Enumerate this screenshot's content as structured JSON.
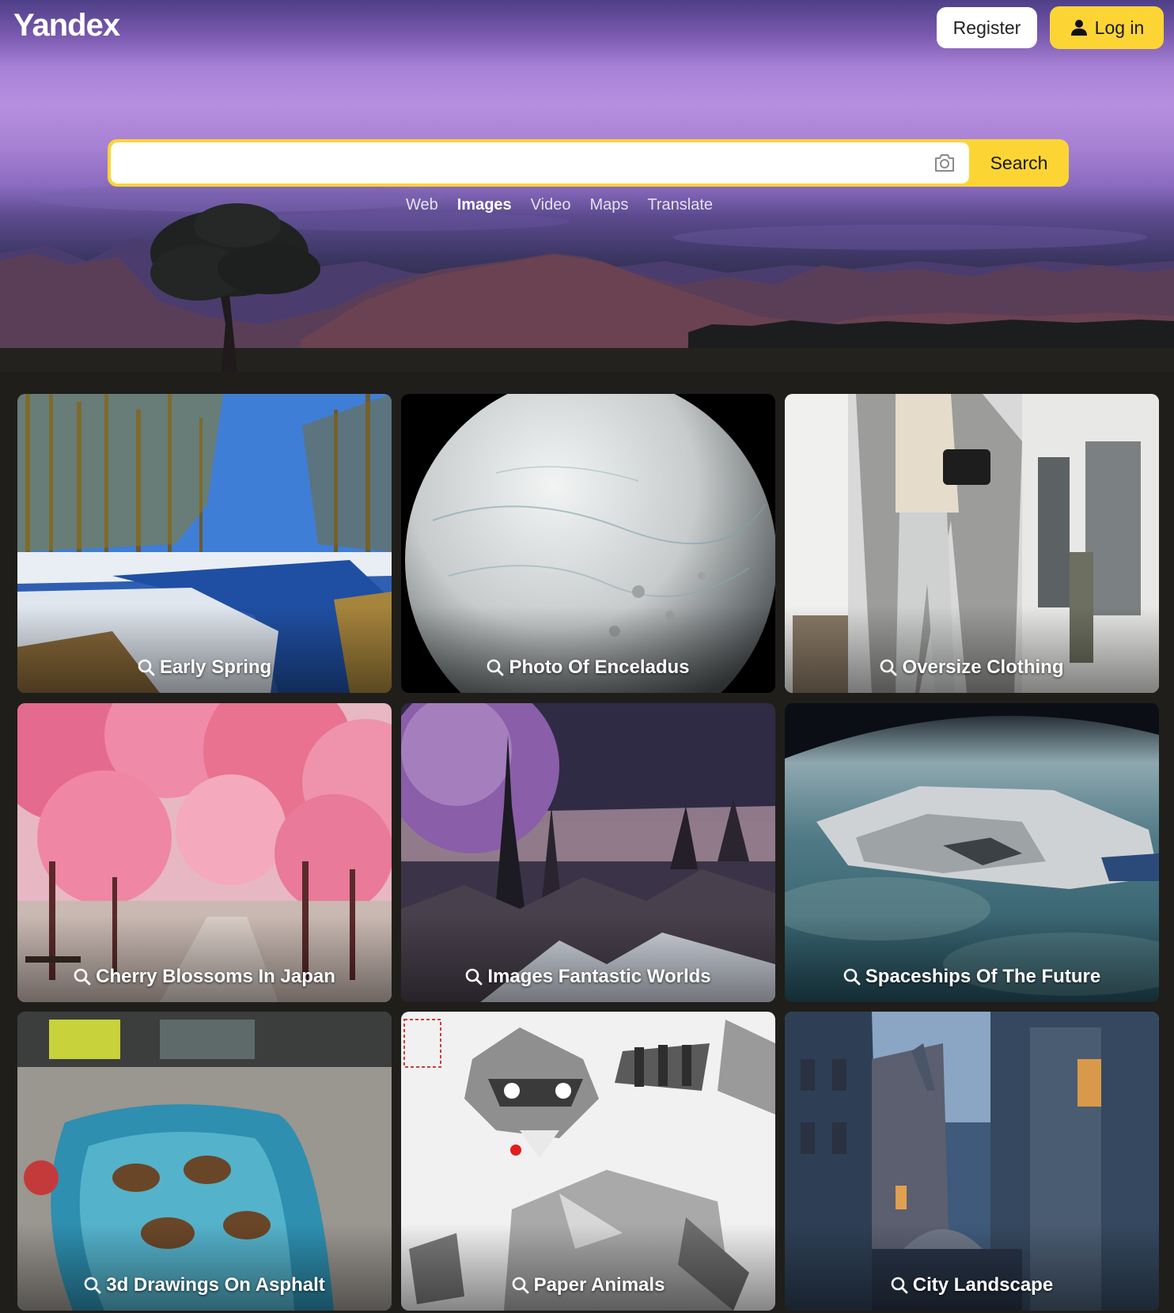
{
  "brand": {
    "logo": "Yandex"
  },
  "header": {
    "register_label": "Register",
    "login_label": "Log in"
  },
  "search": {
    "value": "",
    "placeholder": "",
    "button_label": "Search",
    "camera_icon": "camera-icon"
  },
  "tabs": [
    {
      "label": "Web",
      "active": false
    },
    {
      "label": "Images",
      "active": true
    },
    {
      "label": "Video",
      "active": false
    },
    {
      "label": "Maps",
      "active": false
    },
    {
      "label": "Translate",
      "active": false
    }
  ],
  "colors": {
    "accent": "#fcd535",
    "page_background": "#1f1e1b",
    "hero_sky": "#a781d6"
  },
  "tiles": [
    {
      "caption": "Early Spring",
      "icon": "search-icon"
    },
    {
      "caption": "Photo Of Enceladus",
      "icon": "search-icon"
    },
    {
      "caption": "Oversize Clothing",
      "icon": "search-icon"
    },
    {
      "caption": "Cherry Blossoms In Japan",
      "icon": "search-icon"
    },
    {
      "caption": "Images Fantastic Worlds",
      "icon": "search-icon"
    },
    {
      "caption": "Spaceships Of The Future",
      "icon": "search-icon"
    },
    {
      "caption": "3d Drawings On Asphalt",
      "icon": "search-icon"
    },
    {
      "caption": "Paper Animals",
      "icon": "search-icon"
    },
    {
      "caption": "City Landscape",
      "icon": "search-icon"
    }
  ]
}
